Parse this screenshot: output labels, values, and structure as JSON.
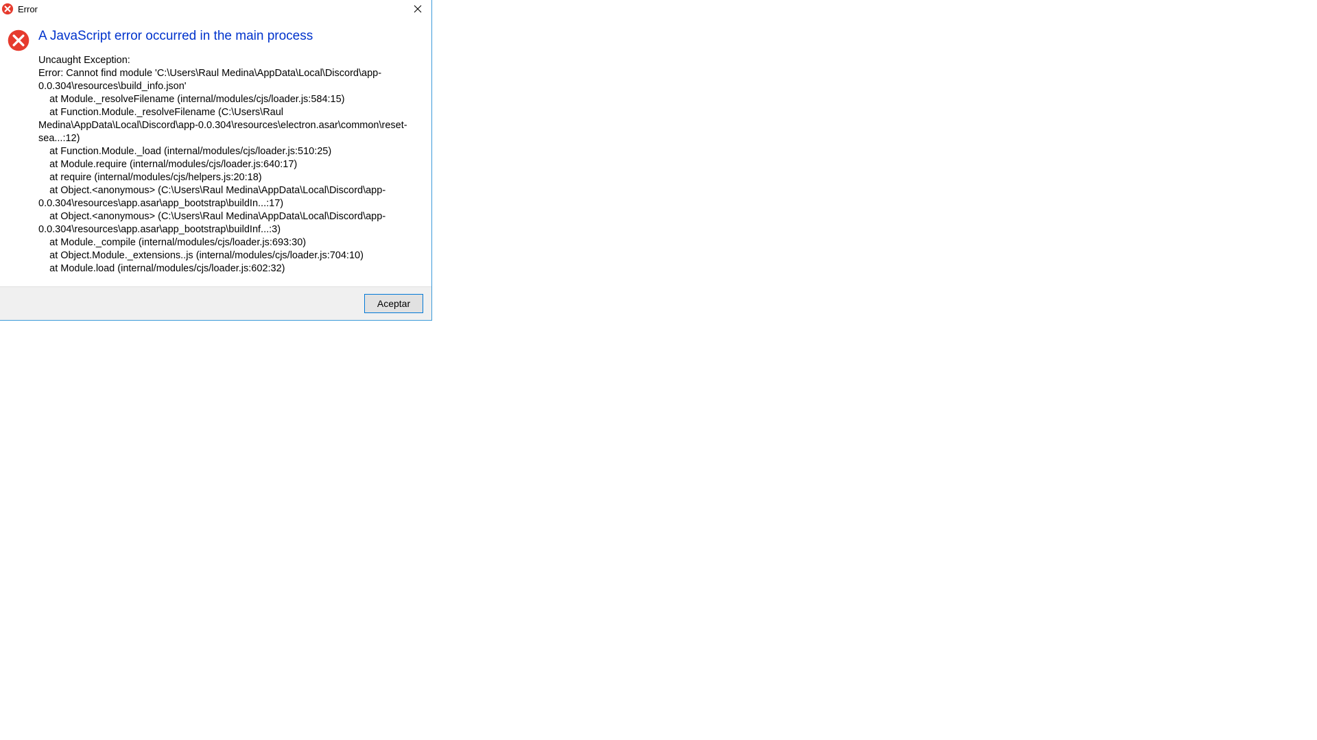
{
  "titlebar": {
    "title": "Error"
  },
  "dialog": {
    "heading": "A JavaScript error occurred in the main process",
    "body": "Uncaught Exception:\nError: Cannot find module 'C:\\Users\\Raul Medina\\AppData\\Local\\Discord\\app-0.0.304\\resources\\build_info.json'\n    at Module._resolveFilename (internal/modules/cjs/loader.js:584:15)\n    at Function.Module._resolveFilename (C:\\Users\\Raul Medina\\AppData\\Local\\Discord\\app-0.0.304\\resources\\electron.asar\\common\\reset-sea...:12)\n    at Function.Module._load (internal/modules/cjs/loader.js:510:25)\n    at Module.require (internal/modules/cjs/loader.js:640:17)\n    at require (internal/modules/cjs/helpers.js:20:18)\n    at Object.<anonymous> (C:\\Users\\Raul Medina\\AppData\\Local\\Discord\\app-0.0.304\\resources\\app.asar\\app_bootstrap\\buildIn...:17)\n    at Object.<anonymous> (C:\\Users\\Raul Medina\\AppData\\Local\\Discord\\app-0.0.304\\resources\\app.asar\\app_bootstrap\\buildInf...:3)\n    at Module._compile (internal/modules/cjs/loader.js:693:30)\n    at Object.Module._extensions..js (internal/modules/cjs/loader.js:704:10)\n    at Module.load (internal/modules/cjs/loader.js:602:32)",
    "ok_label": "Aceptar"
  },
  "colors": {
    "error_red": "#e74c3c",
    "accent_blue": "#0033cc",
    "button_border": "#0078d7"
  }
}
